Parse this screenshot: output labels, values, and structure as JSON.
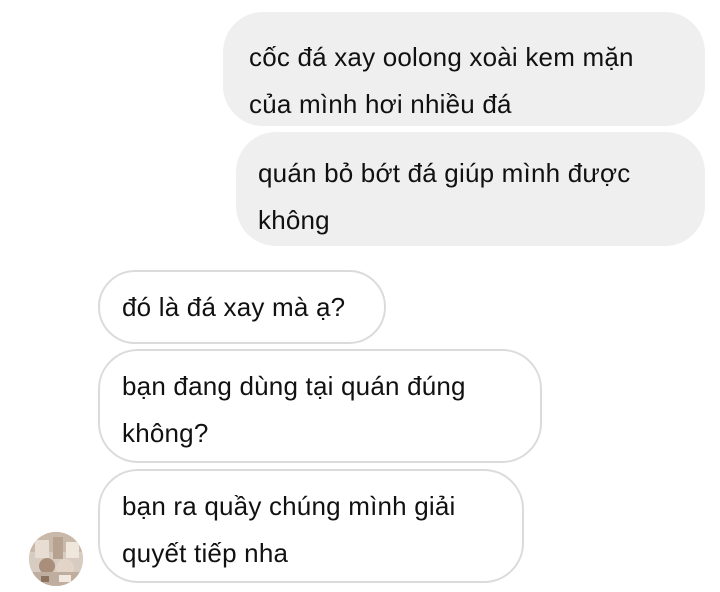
{
  "conversation": {
    "messages": [
      {
        "direction": "outgoing",
        "text": "cốc đá xay oolong xoài kem mặn\ncủa mình hơi nhiều đá"
      },
      {
        "direction": "outgoing",
        "text": "quán bỏ bớt đá giúp mình được\nkhông"
      },
      {
        "direction": "incoming",
        "text": "đó là đá xay mà ạ?"
      },
      {
        "direction": "incoming",
        "text": "bạn đang dùng tại quán đúng\nkhông?"
      },
      {
        "direction": "incoming",
        "text": "bạn ra quầy chúng mình giải\nquyết tiếp nha"
      }
    ]
  },
  "contact": {
    "avatar_icon": "profile-photo-icon"
  },
  "colors": {
    "outgoing_bubble": "#efefef",
    "incoming_border": "#dbdbdb",
    "text": "#111111"
  }
}
